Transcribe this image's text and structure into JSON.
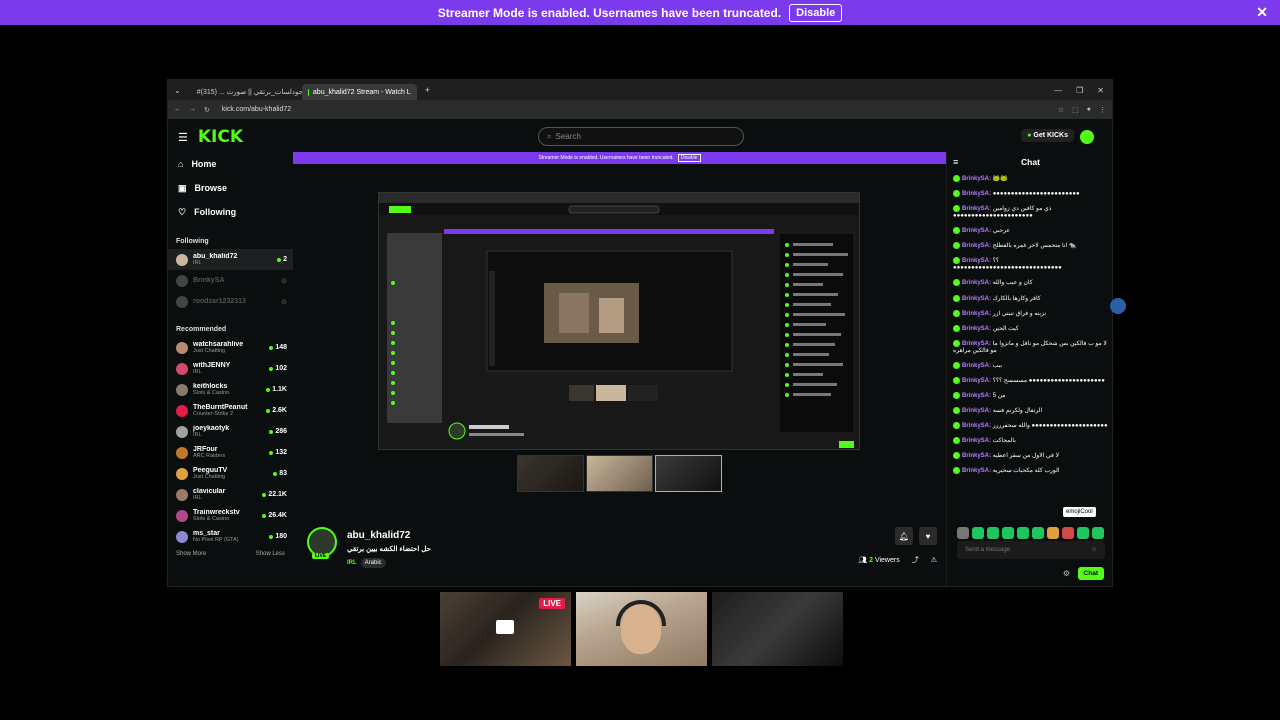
{
  "banner": {
    "text": "Streamer Mode is enabled. Usernames have been truncated.",
    "button": "Disable",
    "close": "✕"
  },
  "browser": {
    "tabs": [
      {
        "label": "#جودلسات_برتقي || صورت ... (315)",
        "active": false,
        "color": "#e11d48"
      },
      {
        "label": "abu_khalid72 Stream - Watch L",
        "active": true,
        "color": "#53fc18"
      }
    ],
    "new_tab": "+",
    "url": "kick.com/abu-khalid72",
    "window_controls": [
      "—",
      "❐",
      "✕"
    ]
  },
  "kick": {
    "logo": "KICK",
    "search_placeholder": "Search",
    "get_kicks": "Get KICKs",
    "nav": [
      {
        "label": "Home",
        "icon": "⌂"
      },
      {
        "label": "Browse",
        "icon": "▣"
      },
      {
        "label": "Following",
        "icon": "♡"
      }
    ],
    "following_title": "Following",
    "following": [
      {
        "name": "abu_khalid72",
        "cat": "IRL",
        "count": "2",
        "color": "#c9b79b",
        "selected": true
      },
      {
        "name": "BrinkySA",
        "cat": "",
        "count": "",
        "color": "#444",
        "dim": true
      },
      {
        "name": "roodzar1232313",
        "cat": "",
        "count": "",
        "color": "#444",
        "dim": true
      }
    ],
    "recommended_title": "Recommended",
    "recommended": [
      {
        "name": "watchsarahlive",
        "cat": "Just Chatting",
        "count": "148",
        "color": "#b88a70"
      },
      {
        "name": "withJENNY",
        "cat": "IRL",
        "count": "102",
        "color": "#d04a6a"
      },
      {
        "name": "keithlocks",
        "cat": "Slots & Casino",
        "count": "1.1K",
        "color": "#8a7a6a"
      },
      {
        "name": "TheBurntPeanut",
        "cat": "Counter-Strike 2",
        "count": "2.6K",
        "color": "#e11d48"
      },
      {
        "name": "joeykaotyk",
        "cat": "IRL",
        "count": "286",
        "color": "#a0a0a0"
      },
      {
        "name": "JRFour",
        "cat": "ARC Raiders",
        "count": "132",
        "color": "#c0782a"
      },
      {
        "name": "PeeguuTV",
        "cat": "Just Chatting",
        "count": "83",
        "color": "#e0a040"
      },
      {
        "name": "clavicular",
        "cat": "IRL",
        "count": "22.1K",
        "color": "#9a7a6a"
      },
      {
        "name": "Trainwreckstv",
        "cat": "Slots & Casino",
        "count": "26.4K",
        "color": "#b04a8a"
      },
      {
        "name": "ms_star",
        "cat": "No Pixel RP (GTA)",
        "count": "180",
        "color": "#8a8ad0"
      }
    ],
    "show_more": "Show More",
    "show_less": "Show Less"
  },
  "stream": {
    "streamer": "abu_khalid72",
    "title": "حل احتضاء الكشه بيين برتقي",
    "category": "IRL",
    "tag": "Arabic",
    "live": "LIVE",
    "viewers_count": "2",
    "viewers_label": "Viewers"
  },
  "chat": {
    "title": "Chat",
    "messages": [
      {
        "user": "BrinkySA:",
        "text": "🐸🐸"
      },
      {
        "user": "BrinkySA:",
        "text": "●●●●●●●●●●●●●●●●●●●●●●●●"
      },
      {
        "user": "BrinkySA:",
        "text": "ذي مو كافين دي زوامين ●●●●●●●●●●●●●●●●●●●●●●"
      },
      {
        "user": "BrinkySA:",
        "text": "عرجبي"
      },
      {
        "user": "BrinkySA:",
        "text": "انا متحمس لاخر غمره بالفطلح 🐀"
      },
      {
        "user": "BrinkySA:",
        "text": "؟؟ ●●●●●●●●●●●●●●●●●●●●●●●●●●●●●●"
      },
      {
        "user": "BrinkySA:",
        "text": "كان و عيب والله"
      },
      {
        "user": "BrinkySA:",
        "text": "كافر وكارها بالكارك"
      },
      {
        "user": "BrinkySA:",
        "text": "نزبنه و فراق ننيتي ازر"
      },
      {
        "user": "BrinkySA:",
        "text": "كيت الحين"
      },
      {
        "user": "BrinkySA:",
        "text": "لا مو ب فالكين بس شحكل مو نافل و مانزوا ما مو فالكين مراهره"
      },
      {
        "user": "BrinkySA:",
        "text": "ببب"
      },
      {
        "user": "BrinkySA:",
        "text": "مسسسح ؟؟؟ ●●●●●●●●●●●●●●●●●●●●●"
      },
      {
        "user": "BrinkySA:",
        "text": "من 5"
      },
      {
        "user": "BrinkySA:",
        "text": "الرتفال ولكرنم فسه"
      },
      {
        "user": "BrinkySA:",
        "text": "والله سحفرررر ●●●●●●●●●●●●●●●●●●●●●"
      },
      {
        "user": "BrinkySA:",
        "text": "بالمحاكت"
      },
      {
        "user": "BrinkySA:",
        "text": "لا في الاول من سقر اعطيه"
      },
      {
        "user": "BrinkySA:",
        "text": "الورب كله مكحبات سخيريه"
      }
    ],
    "tooltip": "emojiCool",
    "input_placeholder": "Send a message",
    "send_label": "Chat",
    "emotes_count": 10
  },
  "colors": {
    "kick_green": "#53fc18",
    "purple": "#7c3aed",
    "chat_user": "#b57cff"
  },
  "bottom": {
    "live": "LIVE"
  }
}
